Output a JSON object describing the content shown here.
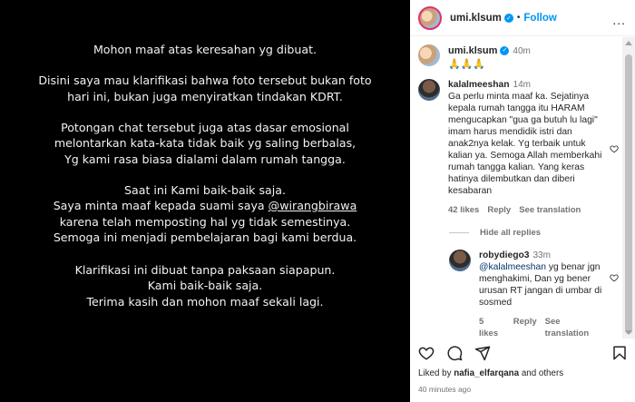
{
  "post_image": {
    "paragraphs": [
      "Mohon maaf atas keresahan yg dibuat.",
      "Disini saya mau klarifikasi bahwa foto tersebut bukan foto\nhari ini, bukan juga menyiratkan tindakan KDRT.",
      "Potongan chat tersebut juga atas dasar emosional\nmelontarkan kata-kata tidak baik yg saling berbalas,\nYg kami rasa biasa dialami dalam rumah tangga."
    ],
    "para4_before": "Saat ini Kami baik-baik saja.\nSaya minta maaf kepada suami saya ",
    "para4_mention": "@wirangbirawa",
    "para4_after": "\nkarena telah memposting hal yg tidak semestinya.\nSemoga ini menjadi pembelajaran bagi kami berdua.",
    "para5": "Klarifikasi ini dibuat tanpa paksaan siapapun.\nKami baik-baik saja.\nTerima kasih dan mohon maaf sekali lagi."
  },
  "header": {
    "username": "umi.klsum",
    "dot": "•",
    "follow_label": "Follow",
    "more_label": "..."
  },
  "caption": {
    "username": "umi.klsum",
    "time": "40m",
    "text": "🙏🙏🙏"
  },
  "comment1": {
    "username": "kalalmeeshan",
    "time": "14m",
    "text": "Ga perlu minta maaf ka. Sejatinya kepala rumah tangga itu HARAM mengucapkan \"gua ga butuh lu lagi\" imam harus mendidik istri dan anak2nya kelak. Yg terbaik untuk kalian ya. Semoga Allah memberkahi rumah tangga kalian. Yang keras hatinya dilembutkan dan diberi kesabaran",
    "likes": "42 likes",
    "reply_label": "Reply",
    "see_translation": "See translation"
  },
  "hide_replies_label": "Hide all replies",
  "reply1": {
    "username": "robydiego3",
    "time": "33m",
    "mention": "@kalalmeeshan",
    "text": " yg benar jgn menghakimi, Dan yg bener urusan RT jangan di umbar di sosmed",
    "likes": "5 likes",
    "reply_label": "Reply",
    "see_translation": "See translation"
  },
  "liked_by": {
    "prefix": "Liked by ",
    "user": "nafia_elfarqana",
    "suffix": " and others"
  },
  "timestamp": "40 minutes ago"
}
